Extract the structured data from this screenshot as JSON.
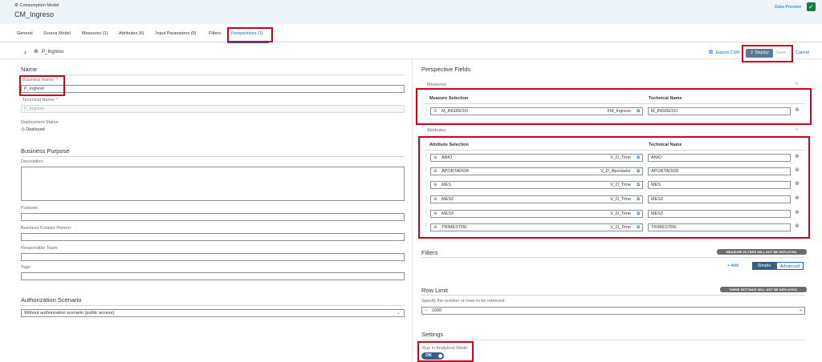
{
  "header": {
    "app_subtitle": "Consumption Model",
    "app_title": "CM_Ingreso",
    "data_preview": "Data Preview"
  },
  "tabs": [
    {
      "label": "General"
    },
    {
      "label": "Source Model"
    },
    {
      "label": "Measures (1)"
    },
    {
      "label": "Attributes (6)"
    },
    {
      "label": "Input Parameters (0)"
    },
    {
      "label": "Filters"
    },
    {
      "label": "Perspectives (1)"
    }
  ],
  "subheader": {
    "perspective_name": "P_Ingreso",
    "export_label": "Export CSN",
    "deploy_label": "Deploy",
    "save_label": "Save",
    "cancel_label": "Cancel"
  },
  "left": {
    "name_section": "Name",
    "business_name_label": "Business Name: *",
    "business_name_value": "P_Ingreso",
    "technical_name_label": "Technical Name: *",
    "technical_name_value": "P_Ingreso",
    "deployment_status_label": "Deployment Status:",
    "deployment_status_value": "Deployed",
    "purpose_section": "Business Purpose",
    "description_label": "Description:",
    "purpose_label": "Purpose:",
    "contact_label": "Business Contact Person:",
    "team_label": "Responsible Team:",
    "tags_label": "Tags:",
    "auth_section": "Authorization Scenario",
    "auth_value": "Without authorization scenario (public access)"
  },
  "right": {
    "fields_section": "Perspective Fields",
    "measures_label": "Measures",
    "measure_col1": "Measure Selection",
    "measure_col2": "Technical Name",
    "measures": [
      {
        "name": "M_INGRESO",
        "source": "FM_Ingreso",
        "tech": "M_INGRESO"
      }
    ],
    "attributes_label": "Attributes",
    "attr_col1": "Attribute Selection",
    "attr_col2": "Technical Name",
    "attributes": [
      {
        "name": "ANIO",
        "source": "V_D_Time",
        "tech": "ANIO"
      },
      {
        "name": "APORTADOR",
        "source": "V_D_Aportador",
        "tech": "APORTADOR"
      },
      {
        "name": "MES",
        "source": "V_D_Time",
        "tech": "MES"
      },
      {
        "name": "MES2",
        "source": "V_D_Time",
        "tech": "MES2"
      },
      {
        "name": "MES3",
        "source": "V_D_Time",
        "tech": "MES3"
      },
      {
        "name": "TRIMESTRE",
        "source": "V_D_Time",
        "tech": "TRIMESTRE"
      }
    ],
    "filters_section": "Filters",
    "filters_badge": "MEASURE FILTERS WILL NOT BE DEPLOYED.",
    "add_label": "Add",
    "simple_label": "Simple",
    "advanced_label": "Advanced",
    "row_limit_section": "Row Limit",
    "row_limit_badge": "THESE SETTINGS WILL NOT BE DEPLOYED.",
    "row_limit_desc": "Specify the number of rows to be retrieved.",
    "row_limit_value": "1000",
    "settings_section": "Settings",
    "analytical_label": "Run in Analytical Mode:",
    "toggle_label": "ON"
  }
}
